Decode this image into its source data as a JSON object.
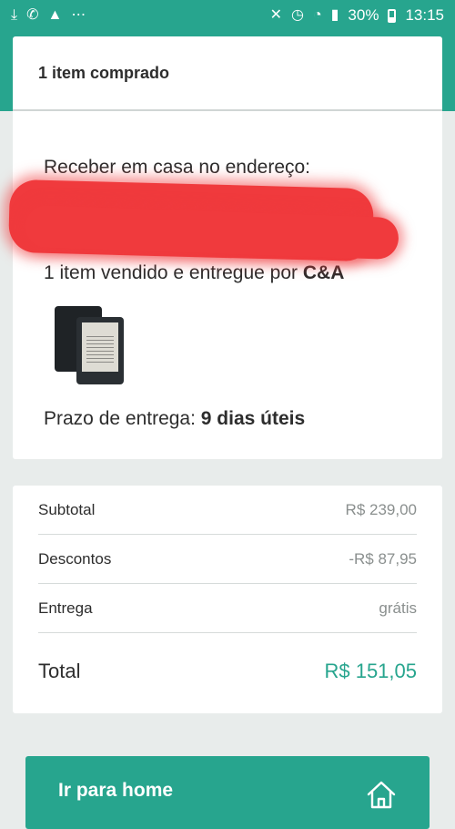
{
  "status_bar": {
    "battery": "30%",
    "time": "13:15",
    "left_icons": [
      "download-icon",
      "whatsapp-icon",
      "warning-icon",
      "more-icon"
    ],
    "right_icons": [
      "mute-icon",
      "alarm-icon",
      "wifi-icon",
      "signal-icon",
      "battery-icon"
    ]
  },
  "header": {
    "title": "1 item comprado"
  },
  "delivery": {
    "receive_label": "Receber em casa no endereço:",
    "address_lines": [
      "",
      "",
      ""
    ],
    "sold_prefix": "1 item vendido e entregue por ",
    "seller": "C&A",
    "product_icon": "kindle-ereader",
    "deadline_prefix": "Prazo de entrega: ",
    "deadline_value": "9 dias úteis"
  },
  "totals": {
    "rows": [
      {
        "label": "Subtotal",
        "value": "R$ 239,00"
      },
      {
        "label": "Descontos",
        "value": "-R$ 87,95"
      },
      {
        "label": "Entrega",
        "value": "grátis"
      }
    ],
    "total_label": "Total",
    "total_value": "R$ 151,05"
  },
  "cta": {
    "label": "Ir para home",
    "icon": "home-icon"
  },
  "colors": {
    "accent": "#27a58e",
    "redaction": "#f03a3d",
    "background": "#e8eceb"
  }
}
